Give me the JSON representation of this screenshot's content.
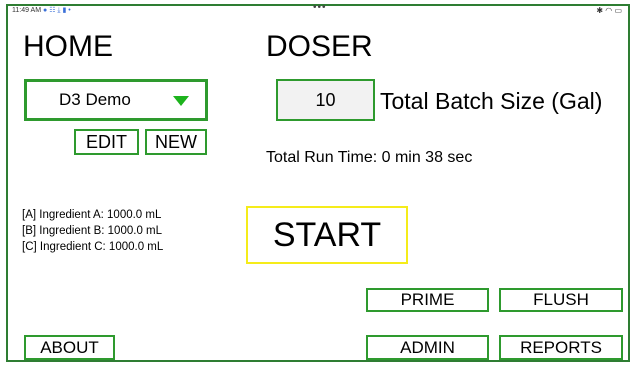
{
  "status_bar": {
    "time": "11:49 AM",
    "left_icons": "● ☷ ⤓ ▮ •",
    "dots": "•••",
    "right_icons": "✱ ◠ ▭"
  },
  "home": {
    "title": "HOME",
    "selected_recipe": "D3 Demo",
    "edit_label": "EDIT",
    "new_label": "NEW",
    "ingredients": [
      "[A] Ingredient A: 1000.0 mL",
      "[B] Ingredient B: 1000.0 mL",
      "[C] Ingredient C: 1000.0 mL"
    ],
    "about_label": "ABOUT"
  },
  "doser": {
    "title": "DOSER",
    "batch_size_value": "10",
    "batch_size_label": "Total Batch Size (Gal)",
    "run_time": "Total Run Time: 0 min 38 sec",
    "start_label": "START",
    "prime_label": "PRIME",
    "flush_label": "FLUSH",
    "admin_label": "ADMIN",
    "reports_label": "REPORTS"
  },
  "colors": {
    "border_green": "#2e9a2e",
    "dropdown_arrow": "#1db31d",
    "start_border": "#f5ec1a",
    "frame_border": "#2e7d32"
  }
}
